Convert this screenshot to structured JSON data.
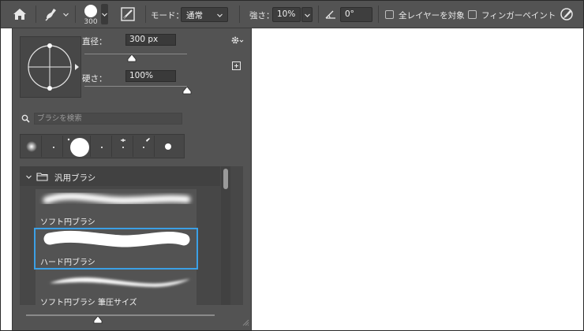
{
  "options_bar": {
    "tool_icon": "brush-tool-icon",
    "preset_size": "300",
    "mode_label": "モード：",
    "mode_value": "通常",
    "strength_label": "強さ：",
    "strength_value": "10%",
    "angle_icon": "angle-icon",
    "angle_value": "0°",
    "sample_all_layers": {
      "label": "全レイヤーを対象",
      "checked": false
    },
    "finger_painting": {
      "label": "フィンガーペイント",
      "checked": false
    }
  },
  "brush_panel": {
    "size": {
      "label": "直径：",
      "value": "300 px",
      "level": 0.5
    },
    "hardness": {
      "label": "硬さ：",
      "value": "100%",
      "level": 1.0
    },
    "search": {
      "placeholder": "ブラシを検索"
    },
    "recent_brushes_count": 7,
    "group": {
      "label": "汎用ブラシ",
      "expanded": true
    },
    "presets": [
      {
        "label": "ソフト円ブラシ",
        "selected": false
      },
      {
        "label": "ハード円ブラシ",
        "selected": true
      },
      {
        "label": "ソフト円ブラシ 筆圧サイズ",
        "selected": false
      }
    ],
    "preview_size_level": 0.38
  },
  "colors": {
    "selection": "#3ba0e6",
    "panel": "#535353"
  }
}
